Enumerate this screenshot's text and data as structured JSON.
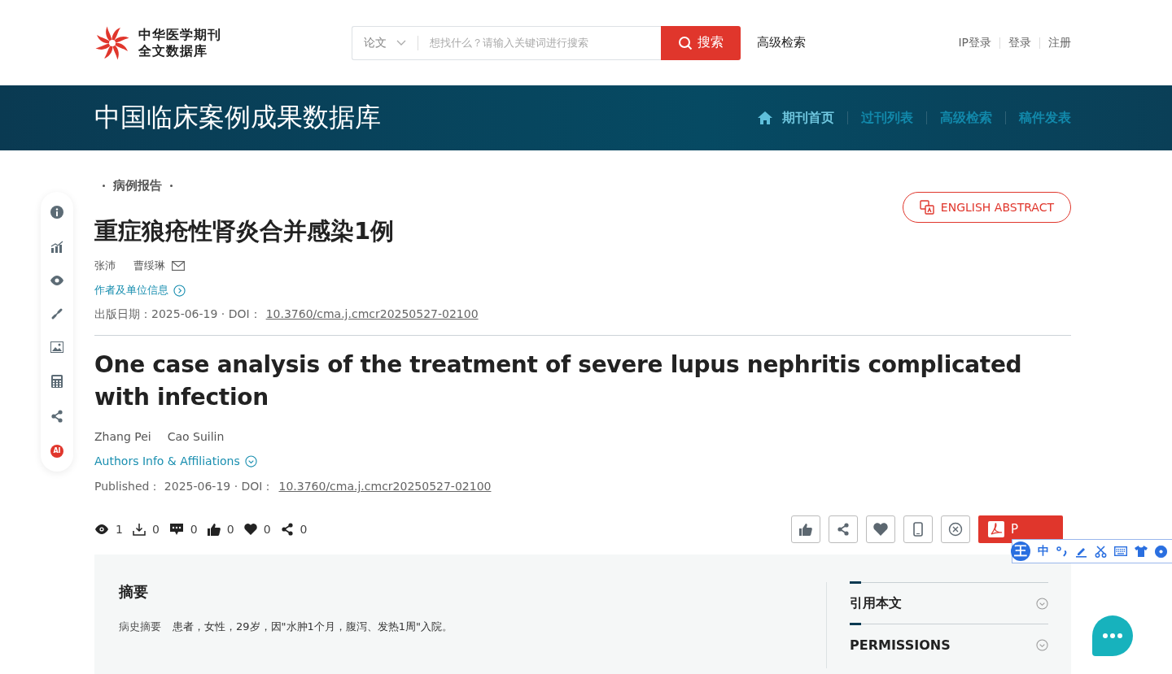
{
  "header": {
    "logo_lines": [
      "中华医学期刊",
      "全文数据库"
    ],
    "search": {
      "scope": "论文",
      "placeholder": "想找什么？请输入关键词进行搜索",
      "button": "搜索"
    },
    "advanced": "高级检索",
    "account_links": [
      "IP登录",
      "登录",
      "注册"
    ]
  },
  "banner": {
    "title": "中国临床案例成果数据库",
    "nav": [
      {
        "label": "期刊首页",
        "selected": true
      },
      {
        "label": "过刊列表",
        "selected": false
      },
      {
        "label": "高级检索",
        "selected": false
      },
      {
        "label": "稿件发表",
        "selected": false
      }
    ]
  },
  "sidebar": {
    "ai_badge": "AI"
  },
  "article": {
    "section": "病例报告",
    "english_abstract_button": "ENGLISH ABSTRACT",
    "title_zh": "重症狼疮性肾炎合并感染1例",
    "authors_zh": [
      {
        "name": "张沛",
        "email": false
      },
      {
        "name": "曹绥琳",
        "email": true
      }
    ],
    "affiliations_zh": "作者及单位信息",
    "published_zh": {
      "label": "出版日期：",
      "date": "2025-06-19",
      "separator": "·",
      "doi_label": "DOI：",
      "doi": "10.3760/cma.j.cmcr20250527-02100"
    },
    "title_en": "One case analysis of the treatment of severe lupus nephritis complicated with infection",
    "authors_en": [
      {
        "name": "Zhang Pei"
      },
      {
        "name": "Cao Suilin"
      }
    ],
    "affiliations_en": "Authors Info & Affiliations",
    "published_en": {
      "label": "Published：",
      "date": "2025-06-19",
      "separator": "·",
      "doi_label": "DOI：",
      "doi": "10.3760/cma.j.cmcr20250527-02100"
    }
  },
  "stats": [
    {
      "kind": "views",
      "count": "1"
    },
    {
      "kind": "downloads",
      "count": "0"
    },
    {
      "kind": "comments",
      "count": "0"
    },
    {
      "kind": "likes",
      "count": "0"
    },
    {
      "kind": "favorites",
      "count": "0"
    },
    {
      "kind": "shares",
      "count": "0"
    }
  ],
  "actions": {
    "buttons": [
      {
        "kind": "like"
      },
      {
        "kind": "share"
      },
      {
        "kind": "favorite"
      },
      {
        "kind": "mobile"
      },
      {
        "kind": "cite"
      }
    ],
    "pdf_button": "P"
  },
  "ime_toolbar": {
    "logo": "王",
    "mode": "中"
  },
  "abstract": {
    "heading": "摘要",
    "paragraphs": [
      {
        "label": "病史摘要",
        "text": "患者，女性，29岁，因\"水肿1个月，腹泻、发热1周\"入院。"
      }
    ]
  },
  "side_panel": [
    {
      "title": "引用本文"
    },
    {
      "title": "PERMISSIONS"
    }
  ]
}
